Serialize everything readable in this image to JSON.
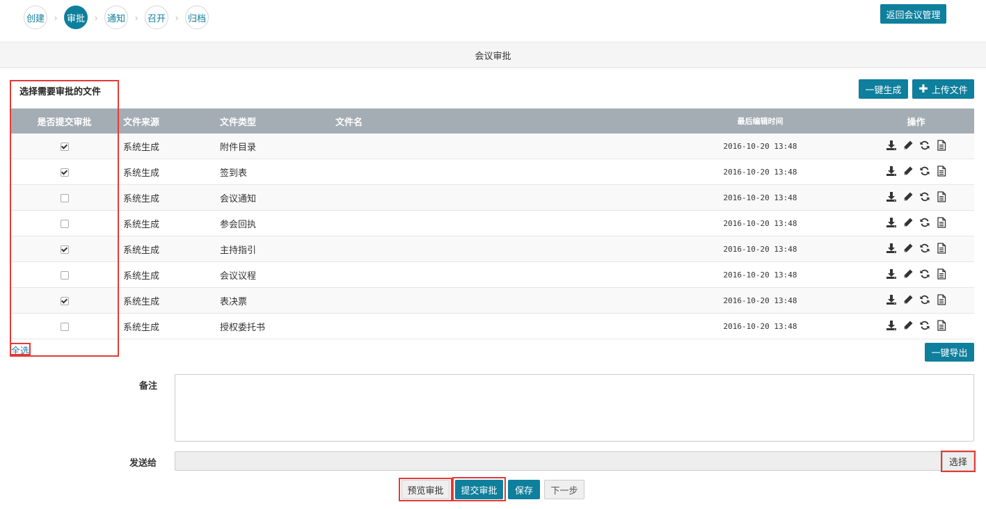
{
  "steps": [
    {
      "label": "创建",
      "active": false
    },
    {
      "label": "审批",
      "active": true
    },
    {
      "label": "通知",
      "active": false
    },
    {
      "label": "召开",
      "active": false
    },
    {
      "label": "归档",
      "active": false
    }
  ],
  "header": {
    "back_button": "返回会议管理",
    "title": "会议审批"
  },
  "section": {
    "title": "选择需要审批的文件",
    "generate_button": "一键生成",
    "upload_button": "上传文件"
  },
  "table": {
    "columns": [
      "是否提交审批",
      "文件来源",
      "文件类型",
      "文件名",
      "最后编辑时间",
      "操作"
    ],
    "rows": [
      {
        "checked": true,
        "source": "系统生成",
        "type": "附件目录",
        "name": "",
        "time": "2016-10-20 13:48"
      },
      {
        "checked": true,
        "source": "系统生成",
        "type": "签到表",
        "name": "",
        "time": "2016-10-20 13:48"
      },
      {
        "checked": false,
        "source": "系统生成",
        "type": "会议通知",
        "name": "",
        "time": "2016-10-20 13:48"
      },
      {
        "checked": false,
        "source": "系统生成",
        "type": "参会回执",
        "name": "",
        "time": "2016-10-20 13:48"
      },
      {
        "checked": true,
        "source": "系统生成",
        "type": "主持指引",
        "name": "",
        "time": "2016-10-20 13:48"
      },
      {
        "checked": false,
        "source": "系统生成",
        "type": "会议议程",
        "name": "",
        "time": "2016-10-20 13:48"
      },
      {
        "checked": true,
        "source": "系统生成",
        "type": "表决票",
        "name": "",
        "time": "2016-10-20 13:48"
      },
      {
        "checked": false,
        "source": "系统生成",
        "type": "授权委托书",
        "name": "",
        "time": "2016-10-20 13:48"
      }
    ],
    "row_actions": [
      "download-icon",
      "edit-icon",
      "refresh-icon",
      "document-icon"
    ]
  },
  "select_all": "全选",
  "export_button": "一键导出",
  "form": {
    "remarks_label": "备注",
    "remarks_value": "",
    "sendto_label": "发送给",
    "sendto_value": "",
    "choose_button": "选择"
  },
  "footer": {
    "preview": "预览审批",
    "submit": "提交审批",
    "save": "保存",
    "next": "下一步"
  },
  "colors": {
    "accent": "#0e7f9c",
    "table_header": "#a4adb4",
    "highlight": "#e53935"
  }
}
